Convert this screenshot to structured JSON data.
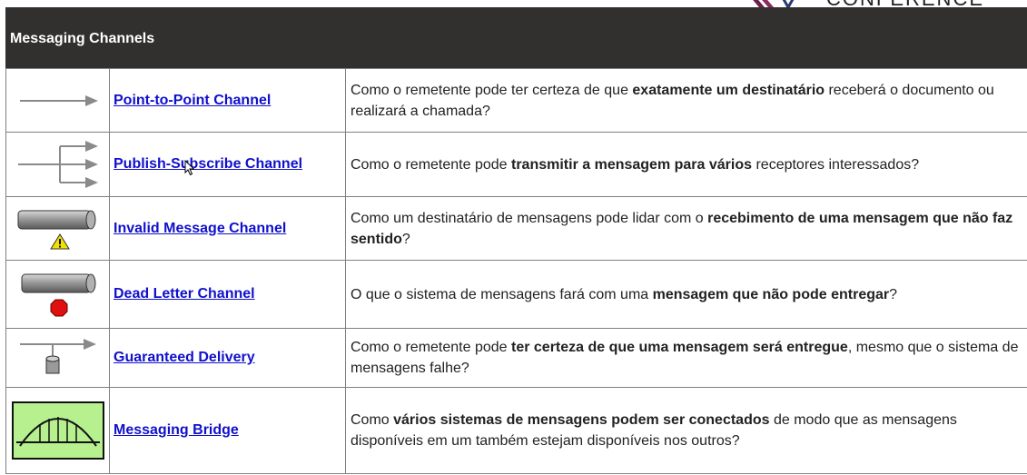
{
  "logo": {
    "wordmark": "CONFERENCE",
    "icon": "conference-logo-mark"
  },
  "header": {
    "title": "Messaging Channels"
  },
  "rows": [
    {
      "icon": "point-to-point-arrow-icon",
      "name": "Point-to-Point Channel",
      "desc": [
        {
          "t": "Como o remetente pode ter certeza de que "
        },
        {
          "t": "exatamente um destinatário",
          "b": true
        },
        {
          "t": " receberá o documento ou realizará a chamada?"
        }
      ]
    },
    {
      "icon": "publish-subscribe-arrows-icon",
      "name": "Publish-Subscribe Channel",
      "desc": [
        {
          "t": "Como o remetente pode "
        },
        {
          "t": "transmitir a mensagem para vários",
          "b": true
        },
        {
          "t": " receptores interessados?"
        }
      ]
    },
    {
      "icon": "pipe-warning-icon",
      "name": "Invalid Message Channel",
      "desc": [
        {
          "t": "Como um destinatário de mensagens pode lidar com o "
        },
        {
          "t": "recebimento de uma mensagem que não faz sentido",
          "b": true
        },
        {
          "t": "?"
        }
      ]
    },
    {
      "icon": "pipe-stop-icon",
      "name": "Dead Letter Channel",
      "desc": [
        {
          "t": "O que o sistema de mensagens fará com uma "
        },
        {
          "t": "mensagem que não pode entregar",
          "b": true
        },
        {
          "t": "?"
        }
      ]
    },
    {
      "icon": "arrow-with-storage-icon",
      "name": "Guaranteed Delivery",
      "desc": [
        {
          "t": "Como o remetente pode "
        },
        {
          "t": "ter certeza de que uma mensagem será entregue",
          "b": true
        },
        {
          "t": ", mesmo que o sistema de mensagens falhe?"
        }
      ]
    },
    {
      "icon": "bridge-icon",
      "name": "Messaging Bridge",
      "desc": [
        {
          "t": "Como "
        },
        {
          "t": "vários sistemas de mensagens podem ser conectados",
          "b": true
        },
        {
          "t": " de modo que as mensagens disponíveis em um também estejam disponíveis nos outros?"
        }
      ]
    }
  ],
  "colors": {
    "header_bg": "#322f2f",
    "link": "#1010cc",
    "bridge_bg": "#b6f08f",
    "stop": "#e01010",
    "warning": "#f2e000"
  }
}
